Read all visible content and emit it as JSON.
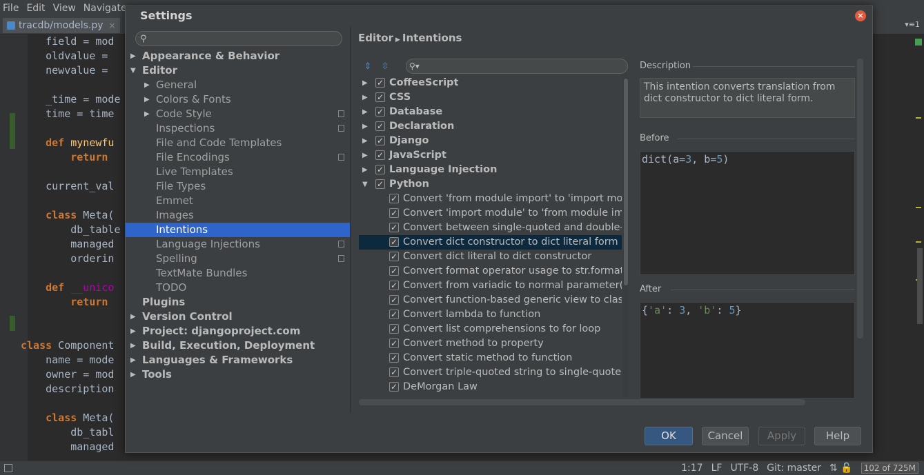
{
  "ide": {
    "menu": [
      "File",
      "Edit",
      "View",
      "Navigate"
    ],
    "file_tab": "tracdb/models.py",
    "code_lines": [
      "    field = mod",
      "    oldvalue = ",
      "    newvalue = ",
      "",
      "    _time = mode",
      "    time = time",
      "",
      "    def mynewfu",
      "        return ",
      "",
      "    current_val",
      "",
      "    class Meta(",
      "        db_table",
      "        managed",
      "        orderin",
      "",
      "    def __unico",
      "        return ",
      "",
      "",
      "class Component",
      "    name = mode",
      "    owner = mod",
      "    description",
      "",
      "    class Meta(",
      "        db_tabl",
      "        managed"
    ],
    "status": {
      "position": "1:17",
      "line_sep": "LF",
      "encoding": "UTF-8",
      "vcs": "Git: master",
      "memory": "102 of 725M"
    }
  },
  "dialog": {
    "title": "Settings",
    "search_placeholder": "",
    "tree": [
      {
        "label": "Appearance & Behavior",
        "level": 0,
        "arrow": "right"
      },
      {
        "label": "Editor",
        "level": 0,
        "arrow": "down"
      },
      {
        "label": "General",
        "level": 1,
        "arrow": "right"
      },
      {
        "label": "Colors & Fonts",
        "level": 1,
        "arrow": "right"
      },
      {
        "label": "Code Style",
        "level": 1,
        "arrow": "right",
        "project": true
      },
      {
        "label": "Inspections",
        "level": 1,
        "project": true
      },
      {
        "label": "File and Code Templates",
        "level": 1
      },
      {
        "label": "File Encodings",
        "level": 1,
        "project": true
      },
      {
        "label": "Live Templates",
        "level": 1
      },
      {
        "label": "File Types",
        "level": 1
      },
      {
        "label": "Emmet",
        "level": 1
      },
      {
        "label": "Images",
        "level": 1
      },
      {
        "label": "Intentions",
        "level": 1,
        "selected": true
      },
      {
        "label": "Language Injections",
        "level": 1,
        "project": true
      },
      {
        "label": "Spelling",
        "level": 1,
        "project": true
      },
      {
        "label": "TextMate Bundles",
        "level": 1
      },
      {
        "label": "TODO",
        "level": 1
      },
      {
        "label": "Plugins",
        "level": 0
      },
      {
        "label": "Version Control",
        "level": 0,
        "arrow": "right"
      },
      {
        "label": "Project: djangoproject.com",
        "level": 0,
        "arrow": "right"
      },
      {
        "label": "Build, Execution, Deployment",
        "level": 0,
        "arrow": "right"
      },
      {
        "label": "Languages & Frameworks",
        "level": 0,
        "arrow": "right"
      },
      {
        "label": "Tools",
        "level": 0,
        "arrow": "right"
      }
    ],
    "breadcrumb": {
      "parent": "Editor",
      "current": "Intentions"
    },
    "intentions": [
      {
        "label": "CoffeeScript",
        "group": true,
        "arrow": "right",
        "checked": true
      },
      {
        "label": "CSS",
        "group": true,
        "arrow": "right",
        "checked": true
      },
      {
        "label": "Database",
        "group": true,
        "arrow": "right",
        "checked": true
      },
      {
        "label": "Declaration",
        "group": true,
        "arrow": "right",
        "checked": true
      },
      {
        "label": "Django",
        "group": true,
        "arrow": "right",
        "checked": true
      },
      {
        "label": "JavaScript",
        "group": true,
        "arrow": "right",
        "checked": true
      },
      {
        "label": "Language Injection",
        "group": true,
        "arrow": "right",
        "checked": true
      },
      {
        "label": "Python",
        "group": true,
        "arrow": "down",
        "checked": true
      },
      {
        "label": "Convert 'from module import' to 'import module",
        "checked": true
      },
      {
        "label": "Convert 'import module' to 'from module impor",
        "checked": true
      },
      {
        "label": "Convert between single-quoted and double-qu",
        "checked": true
      },
      {
        "label": "Convert dict constructor to dict literal form",
        "checked": true,
        "selected": true
      },
      {
        "label": "Convert dict literal to dict constructor",
        "checked": true
      },
      {
        "label": "Convert format operator usage to str.format m",
        "checked": true
      },
      {
        "label": "Convert from variadic to normal parameter(s)",
        "checked": true
      },
      {
        "label": "Convert function-based generic view to class-b",
        "checked": true
      },
      {
        "label": "Convert lambda to function",
        "checked": true
      },
      {
        "label": "Convert list comprehensions to for loop",
        "checked": true
      },
      {
        "label": "Convert method to property",
        "checked": true
      },
      {
        "label": "Convert static method to function",
        "checked": true
      },
      {
        "label": "Convert triple-quoted string to single-quoted s",
        "checked": true
      },
      {
        "label": "DeMorgan Law",
        "checked": true
      }
    ],
    "description": {
      "label": "Description",
      "text": "This intention converts translation from dict constructor to dict literal form."
    },
    "before": {
      "label": "Before",
      "code": "dict(a=3, b=5)"
    },
    "after": {
      "label": "After",
      "code": "{'a': 3, 'b': 5}"
    },
    "buttons": {
      "ok": "OK",
      "cancel": "Cancel",
      "apply": "Apply",
      "help": "Help"
    }
  }
}
